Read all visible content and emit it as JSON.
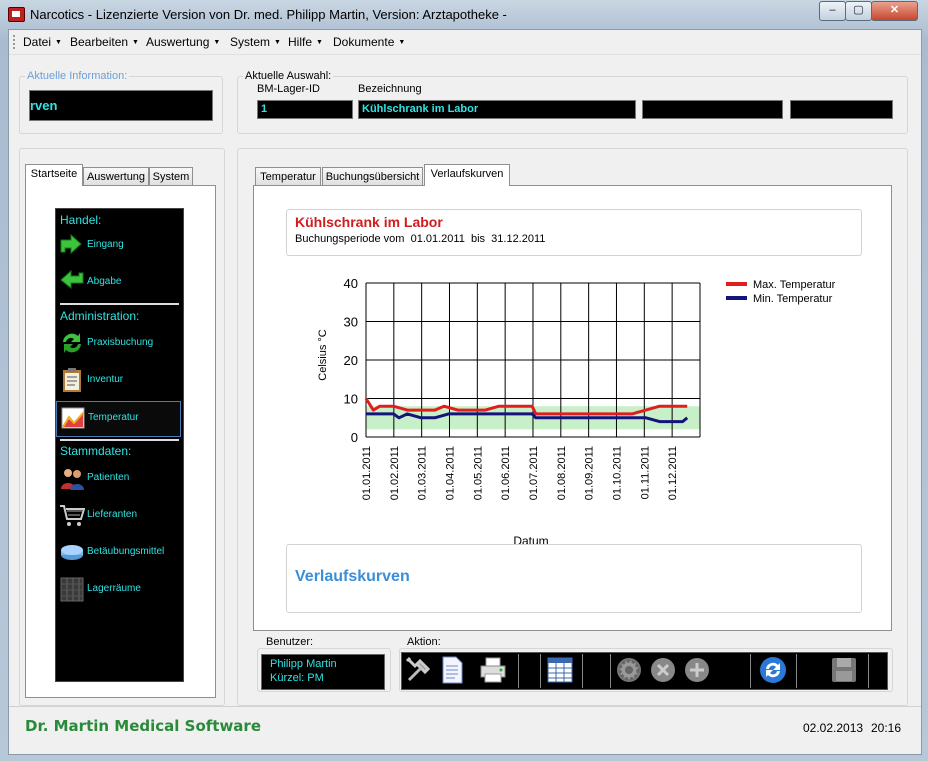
{
  "window": {
    "title": "Narcotics - Lizenzierte Version von Dr. med. Philipp Martin, Version: Arztapotheke -",
    "controls": {
      "minimize": "‒",
      "maximize": "▢",
      "close": "✕"
    }
  },
  "menu": [
    {
      "label": "Datei"
    },
    {
      "label": "Bearbeiten"
    },
    {
      "label": "Auswertung"
    },
    {
      "label": "System"
    },
    {
      "label": "Hilfe"
    },
    {
      "label": "Dokumente"
    }
  ],
  "current_info": {
    "title": "Aktuelle Information:",
    "value": "rven"
  },
  "current_selection": {
    "title": "Aktuelle Auswahl:",
    "id_label": "BM-Lager-ID",
    "id_value": "1",
    "name_label": "Bezeichnung",
    "name_value": "Kühlschrank im Labor",
    "extra1": "",
    "extra2": ""
  },
  "left_tabs": [
    "Startseite",
    "Auswertung",
    "System"
  ],
  "nav": {
    "sections": [
      {
        "heading": "Handel:",
        "items": [
          {
            "label": "Eingang",
            "icon": "arrow-in-icon"
          },
          {
            "label": "Abgabe",
            "icon": "arrow-out-icon"
          }
        ]
      },
      {
        "heading": "Administration:",
        "items": [
          {
            "label": "Praxisbuchung",
            "icon": "refresh-icon"
          },
          {
            "label": "Inventur",
            "icon": "clipboard-icon"
          },
          {
            "label": "Temperatur",
            "icon": "chart-icon"
          }
        ]
      },
      {
        "heading": "Stammdaten:",
        "items": [
          {
            "label": "Patienten",
            "icon": "people-icon"
          },
          {
            "label": "Lieferanten",
            "icon": "cart-icon"
          },
          {
            "label": "Betäubungsmittel",
            "icon": "pill-icon"
          },
          {
            "label": "Lagerräume",
            "icon": "cabinet-icon"
          }
        ]
      }
    ]
  },
  "main_tabs": [
    "Temperatur",
    "Buchungsübersicht",
    "Verlaufskurven"
  ],
  "chart_header": {
    "title": "Kühlschrank im Labor",
    "period_prefix": "Buchungsperiode vom",
    "from": "01.01.2011",
    "to_word": "bis",
    "to": "31.12.2011"
  },
  "chart_data": {
    "type": "line",
    "xlabel": "Datum",
    "ylabel": "Celsius °C",
    "ylim": [
      0,
      40
    ],
    "yticks": [
      0,
      10,
      20,
      30,
      40
    ],
    "x_ticks": [
      "01.01.2011",
      "01.02.2011",
      "01.03.2011",
      "01.04.2011",
      "01.05.2011",
      "01.06.2011",
      "01.07.2011",
      "01.08.2011",
      "01.09.2011",
      "01.10.2011",
      "01.11.2011",
      "01.12.2011"
    ],
    "x_range_days": [
      0,
      364
    ],
    "grid": true,
    "legend_position": "top-right",
    "band": {
      "from": 2,
      "to": 8,
      "color": "#c8f0c8"
    },
    "series": [
      {
        "name": "Max. Temperatur",
        "color": "#e01e1e",
        "x": [
          0,
          8,
          15,
          30,
          45,
          60,
          75,
          85,
          100,
          115,
          130,
          145,
          160,
          175,
          181,
          185,
          200,
          215,
          230,
          245,
          260,
          275,
          290,
          305,
          320,
          335,
          350
        ],
        "y": [
          10,
          7,
          8,
          8,
          7,
          7,
          7,
          8,
          7,
          7,
          7,
          8,
          8,
          8,
          8,
          6,
          6,
          6,
          6,
          6,
          6,
          6,
          6,
          7,
          8,
          8,
          8
        ]
      },
      {
        "name": "Min. Temperatur",
        "color": "#14147a",
        "x": [
          0,
          15,
          30,
          36,
          45,
          60,
          75,
          90,
          105,
          120,
          135,
          150,
          165,
          181,
          185,
          200,
          215,
          230,
          245,
          260,
          275,
          290,
          305,
          320,
          335,
          345,
          350
        ],
        "y": [
          6,
          6,
          6,
          5,
          6,
          5,
          5,
          6,
          6,
          6,
          6,
          6,
          6,
          6,
          5,
          5,
          5,
          5,
          5,
          5,
          5,
          5,
          5,
          4,
          4,
          4,
          5
        ]
      }
    ]
  },
  "section_title": "Verlaufskurven",
  "user_box": {
    "title": "Benutzer:",
    "name": "Philipp Martin",
    "short": "Kürzel: PM"
  },
  "action_box": {
    "title": "Aktion:"
  },
  "footer": {
    "brand": "Dr. Martin Medical Software",
    "date": "02.02.2013",
    "time": "20:16"
  }
}
